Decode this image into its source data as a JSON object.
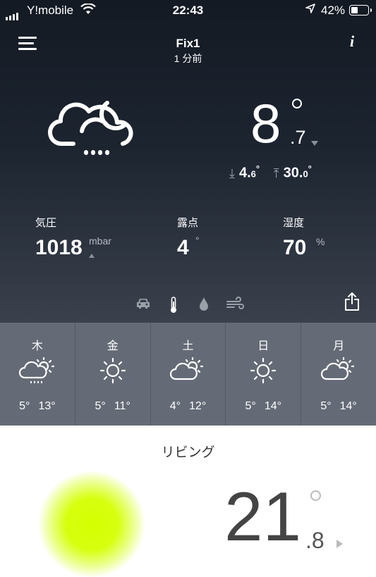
{
  "status_bar": {
    "carrier": "Y!mobile",
    "time": "22:43",
    "battery_percent": "42%",
    "battery_level": 0.42,
    "icons": [
      "signal-icon",
      "wifi-icon",
      "location-arrow-icon",
      "battery-icon"
    ]
  },
  "header": {
    "station": "Fix1",
    "updated": "1 分前",
    "menu_icon": "hamburger-menu-icon",
    "info_icon": "info-icon"
  },
  "outdoor": {
    "condition_icon": "cloudy-rain-night-icon",
    "temp_int": "8",
    "temp_dec": ".7",
    "min_label": "4.",
    "min_dec": "6",
    "max_label": "30.",
    "max_dec": "0",
    "deg": "°"
  },
  "stats": {
    "pressure": {
      "label": "気圧",
      "value": "1018",
      "unit": "mbar"
    },
    "dewpoint": {
      "label": "露点",
      "value": "4",
      "unit": "°"
    },
    "humidity": {
      "label": "湿度",
      "value": "70",
      "unit": "%"
    }
  },
  "module_icons": [
    "car-icon",
    "thermometer-icon",
    "rain-drop-icon",
    "wind-icon"
  ],
  "share_icon": "share-icon",
  "forecast": [
    {
      "day": "木",
      "icon": "cloudy-rain-icon",
      "low": "5°",
      "high": "13°"
    },
    {
      "day": "金",
      "icon": "sun-icon",
      "low": "5°",
      "high": "11°"
    },
    {
      "day": "土",
      "icon": "partly-cloudy-icon",
      "low": "4°",
      "high": "12°"
    },
    {
      "day": "日",
      "icon": "sun-icon",
      "low": "5°",
      "high": "14°"
    },
    {
      "day": "月",
      "icon": "partly-cloudy-icon",
      "low": "5°",
      "high": "14°"
    }
  ],
  "indoor": {
    "room": "リビング",
    "temp_int": "21",
    "temp_dec": ".8",
    "air_quality_color": "#d4ff00"
  }
}
